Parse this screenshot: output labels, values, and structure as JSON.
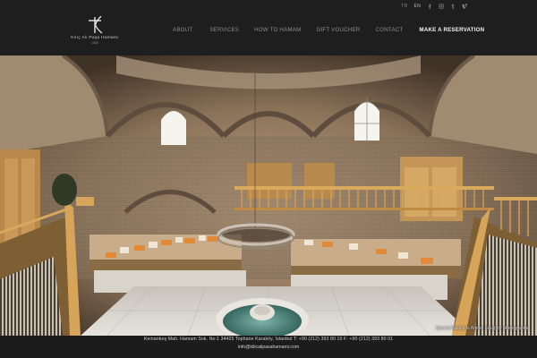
{
  "topbar": {
    "languages": [
      "TR",
      "EN"
    ],
    "active_language": "EN",
    "social": [
      {
        "name": "facebook-icon",
        "glyph": "f"
      },
      {
        "name": "instagram-icon",
        "glyph": "◎"
      },
      {
        "name": "tumblr-icon",
        "glyph": "t"
      },
      {
        "name": "vimeo-icon",
        "glyph": "v"
      }
    ]
  },
  "logo": {
    "name": "Kılıç Ali Paşa Hamamı",
    "year": "1580"
  },
  "nav": {
    "items": [
      {
        "label": "About"
      },
      {
        "label": "Services"
      },
      {
        "label": "How to Hamam"
      },
      {
        "label": "Gift Voucher"
      },
      {
        "label": "Contact"
      }
    ],
    "cta": "Make a Reservation"
  },
  "hero": {
    "credit": "Special thanks to Ahmet Ertuğ for photographs"
  },
  "footer": {
    "address": "Kemankeş Mah. Hamam Sok. No:1 34425 Tophane Karaköy, İstanbul T: +90 (212) 393 80 10 F: +90 (212) 393 80 01",
    "email": "info@kilicalipasahamami.com"
  },
  "colors": {
    "header_bg": "#1e1e1e",
    "nav_text": "#8c8c8c",
    "cta_text": "#f2f2f2",
    "footer_bg": "#1c1c1c",
    "wood": "#c79a55"
  }
}
